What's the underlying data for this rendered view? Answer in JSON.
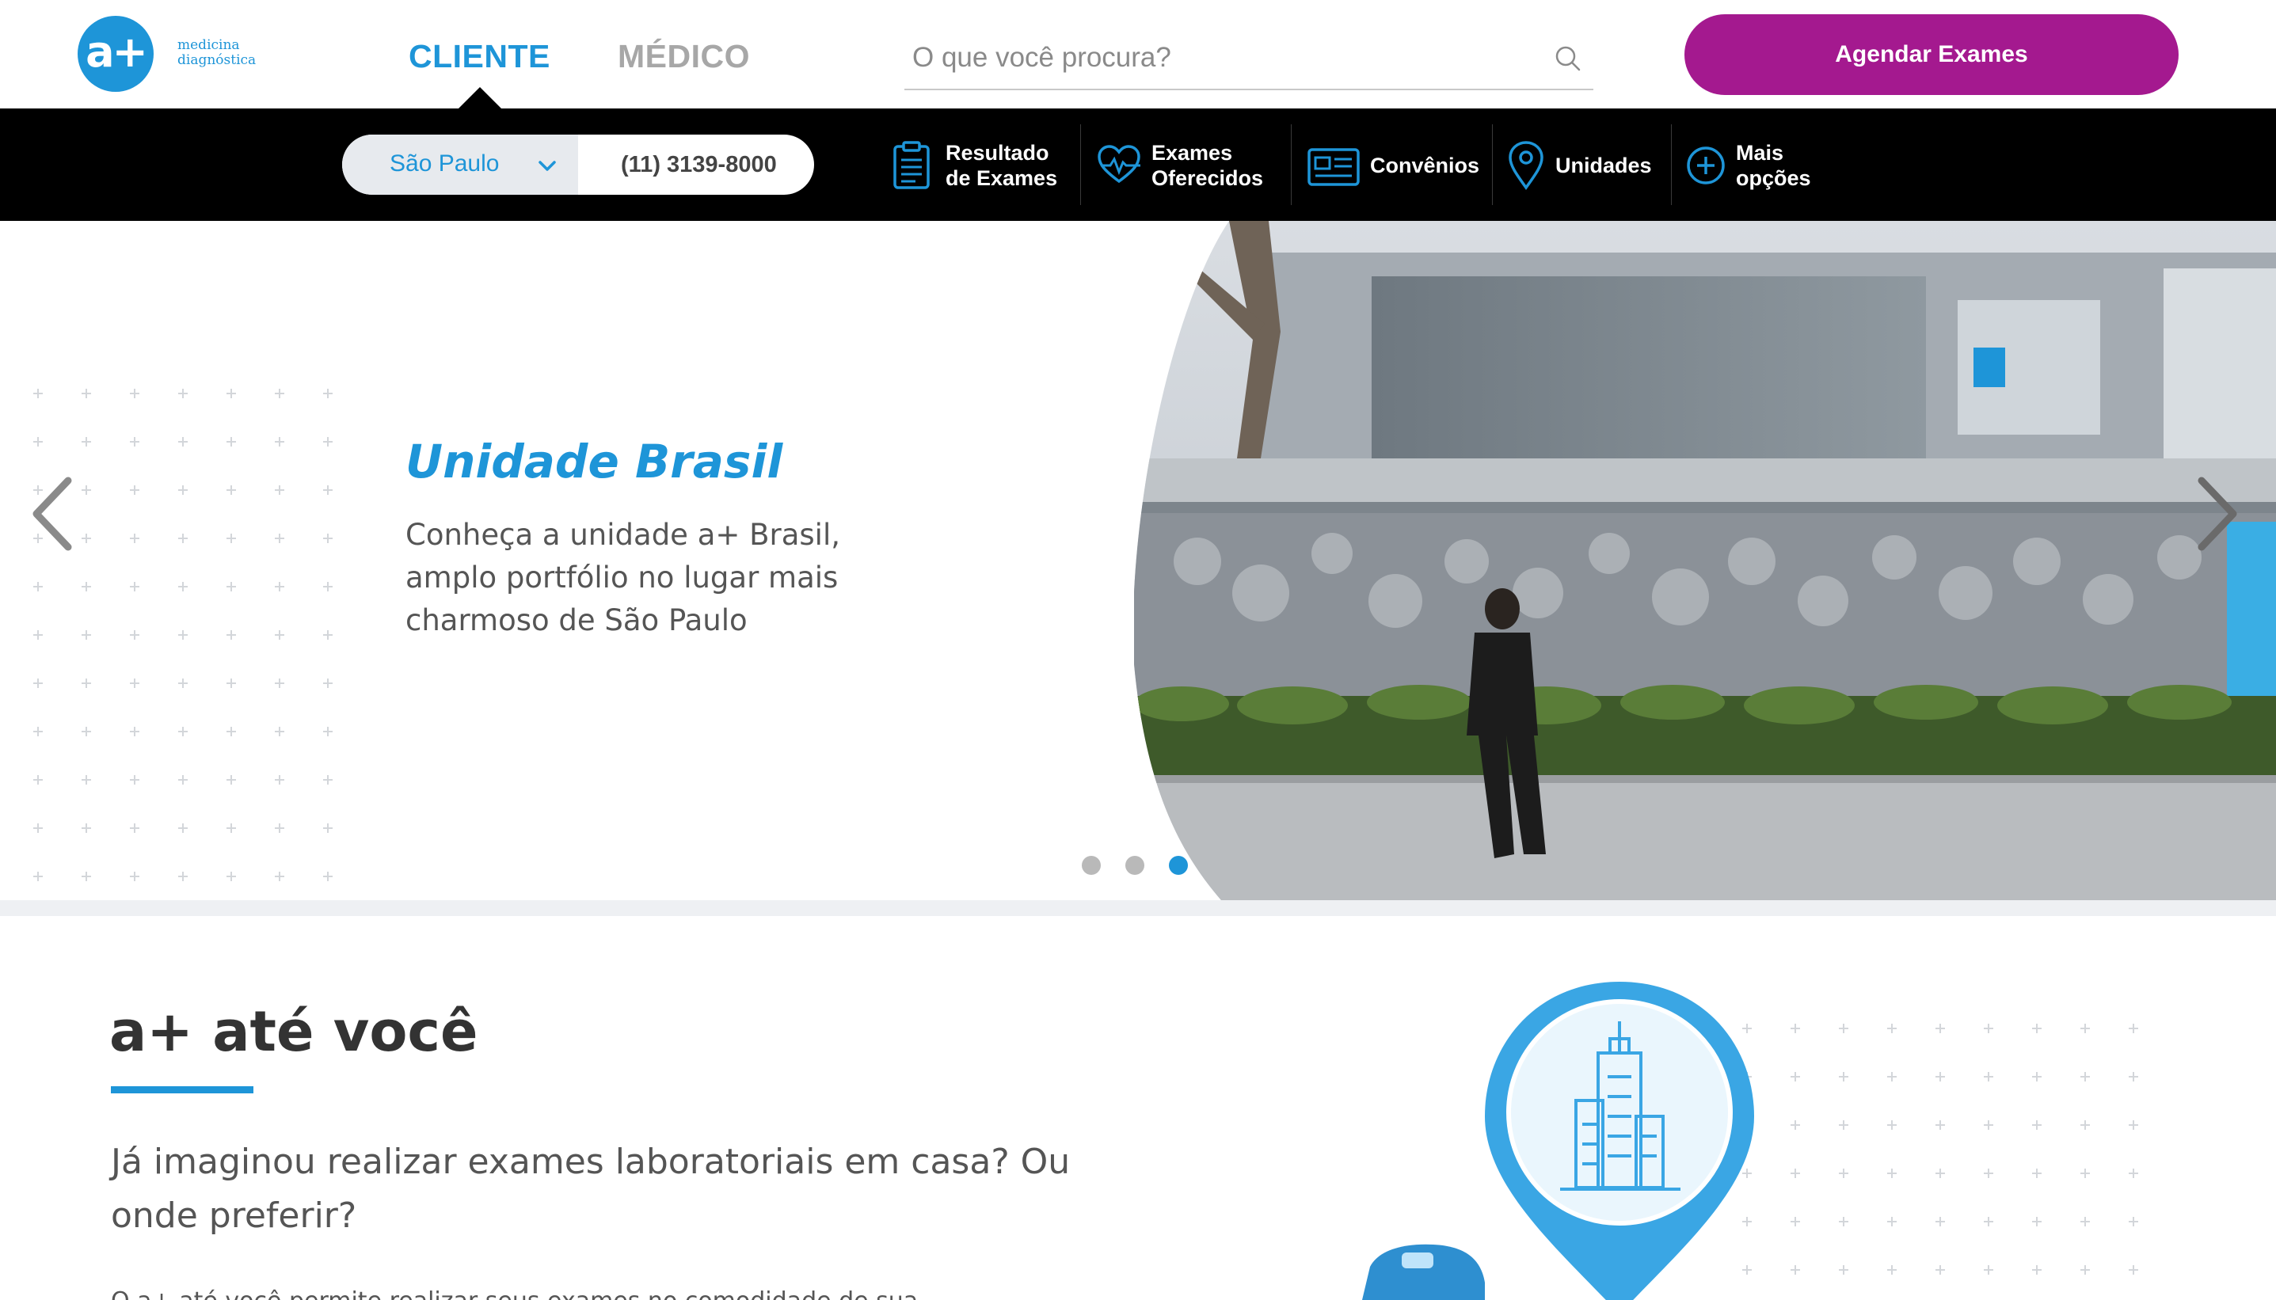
{
  "header": {
    "logo": {
      "mark": "a+",
      "line1": "medicina",
      "line2": "diagnóstica"
    },
    "tabs": [
      {
        "label": "CLIENTE",
        "active": true
      },
      {
        "label": "MÉDICO",
        "active": false
      }
    ],
    "search": {
      "placeholder": "O que você procura?",
      "value": ""
    },
    "cta_label": "Agendar Exames"
  },
  "navbar": {
    "city": "São Paulo",
    "phone": "(11) 3139-8000",
    "items": [
      {
        "label_line1": "Resultado",
        "label_line2": "de Exames",
        "icon": "clipboard-icon"
      },
      {
        "label_line1": "Exames",
        "label_line2": "Oferecidos",
        "icon": "heart-pulse-icon"
      },
      {
        "label_line1": "Convênios",
        "label_line2": "",
        "icon": "card-icon"
      },
      {
        "label_line1": "Unidades",
        "label_line2": "",
        "icon": "map-pin-icon"
      },
      {
        "label_line1": "Mais",
        "label_line2": "opções",
        "icon": "plus-circle-icon"
      }
    ]
  },
  "hero": {
    "title": "Unidade Brasil",
    "description": "Conheça a unidade a+ Brasil, amplo portfólio no lugar mais charmoso de São Paulo",
    "slides_total": 3,
    "active_slide": 3
  },
  "section": {
    "title": "a+ até você",
    "subtitle": "Já imaginou realizar exames laboratoriais em casa? Ou onde preferir?",
    "body": "O a+ até você permite realizar seus exames no comodidade de sua casa, no"
  },
  "colors": {
    "brand_blue": "#1e95d8",
    "cta_magenta": "#a4198f",
    "nav_black": "#000000"
  }
}
